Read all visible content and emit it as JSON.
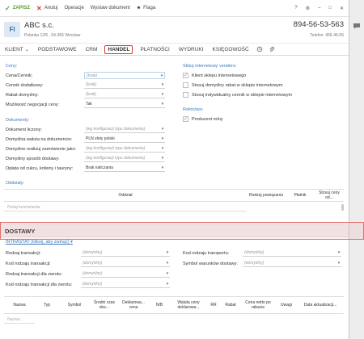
{
  "toolbar": {
    "save": "ZAPISZ",
    "cancel": "Anuluj",
    "operations": "Operacje",
    "issue_doc": "Wystaw dokument",
    "flag": "Flaga"
  },
  "header": {
    "initials": "FI",
    "name": "ABC s.c.",
    "address": "Polanka 12/6 , 54-365 Wrocław",
    "phone": "894-56-53-563",
    "phone_sub": "Telefon: 456-46-55"
  },
  "tabs": [
    {
      "label": "KLIENT ⌄"
    },
    {
      "label": "PODSTAWOWE"
    },
    {
      "label": "CRM"
    },
    {
      "label": "HANDEL",
      "active": true
    },
    {
      "label": "PŁATNOŚCI"
    },
    {
      "label": "WYDRUKI"
    },
    {
      "label": "KSIĘGOWOŚĆ"
    }
  ],
  "prices": {
    "title": "Ceny:",
    "rows": [
      {
        "label": "Cena/Cennik:",
        "value": "(brak)",
        "placeholder": true
      },
      {
        "label": "Cennik dodatkowy:",
        "value": "(brak)",
        "placeholder": true
      },
      {
        "label": "Rabat domyślny:",
        "value": "(brak)",
        "placeholder": true
      },
      {
        "label": "Możliwość negocjacji ceny:",
        "value": "Tak",
        "placeholder": false
      }
    ]
  },
  "documents": {
    "title": "Dokumenty:",
    "rows": [
      {
        "label": "Dokument liczony:",
        "value": "(wg konfiguracji typu dokumentu)",
        "placeholder": true
      },
      {
        "label": "Domyślna waluta na dokumencie:",
        "value": "PLN złoty polski",
        "placeholder": false
      },
      {
        "label": "Domyślne realizuj zamówienie jako:",
        "value": "(wg konfiguracji typu dokumentu)",
        "placeholder": true
      },
      {
        "label": "Domyślny sposób dostawy:",
        "value": "(wg konfiguracji typu dokumentu)",
        "placeholder": true
      },
      {
        "label": "Opłata od cukru, kofeiny i tauryny:",
        "value": "Brak naliczania",
        "placeholder": false
      }
    ]
  },
  "webshop": {
    "title": "Sklep internetowy vendero:",
    "items": [
      {
        "label": "Klient sklepu internetowego",
        "checked": true
      },
      {
        "label": "Stosuj domyślny rabat w sklepie internetowym",
        "checked": false
      },
      {
        "label": "Stosuj indywidualny cennik w sklepie internetowym",
        "checked": false
      }
    ]
  },
  "farmer": {
    "title": "Rolnictwo:",
    "items": [
      {
        "label": "Producent rolny",
        "checked": true
      }
    ]
  },
  "branches": {
    "title": "Oddziały:",
    "columns": [
      "Oddział",
      "Rodzaj powiązania",
      "Płatnik",
      "Stosuj ceny od..."
    ],
    "filter_placeholder": "Podaj kontrahenta"
  },
  "delivery": {
    "band_title": "DOSTAWY",
    "intrastat_link": "INTRASTAT (kliknij, aby zwinąć) ▾",
    "left_rows": [
      {
        "label": "Rodzaj transakcji:",
        "value": "(domyślny)"
      },
      {
        "label": "Kod rodzaju transakcji:",
        "value": "(domyślny)"
      },
      {
        "label": "Rodzaj transakcji dla zwrotu:",
        "value": "(domyślny)"
      },
      {
        "label": "Kod rodzaju transakcji dla zwrotu:",
        "value": "(domyślny)"
      }
    ],
    "right_rows": [
      {
        "label": "Kod rodzaju transportu:",
        "value": "(domyślny)"
      },
      {
        "label": "Symbol warunków dostawy:",
        "value": "(domyślny)"
      }
    ],
    "columns": [
      "Nazwa",
      "Typ",
      "Symbol",
      "Średni czas dos...",
      "Deklarowa... cena",
      "N/B",
      "Waluta ceny deklarowa...",
      "RR",
      "Rabat",
      "Cena netto po rabacie",
      "Uwagi",
      "Data aktualizacji..."
    ],
    "filter_placeholder": "Nazwa..."
  },
  "colors": {
    "accent": "#3a7ab8",
    "save_green": "#5a9a2f",
    "cancel_red": "#d23a2a",
    "active_tab_border": "#d73a3a"
  }
}
